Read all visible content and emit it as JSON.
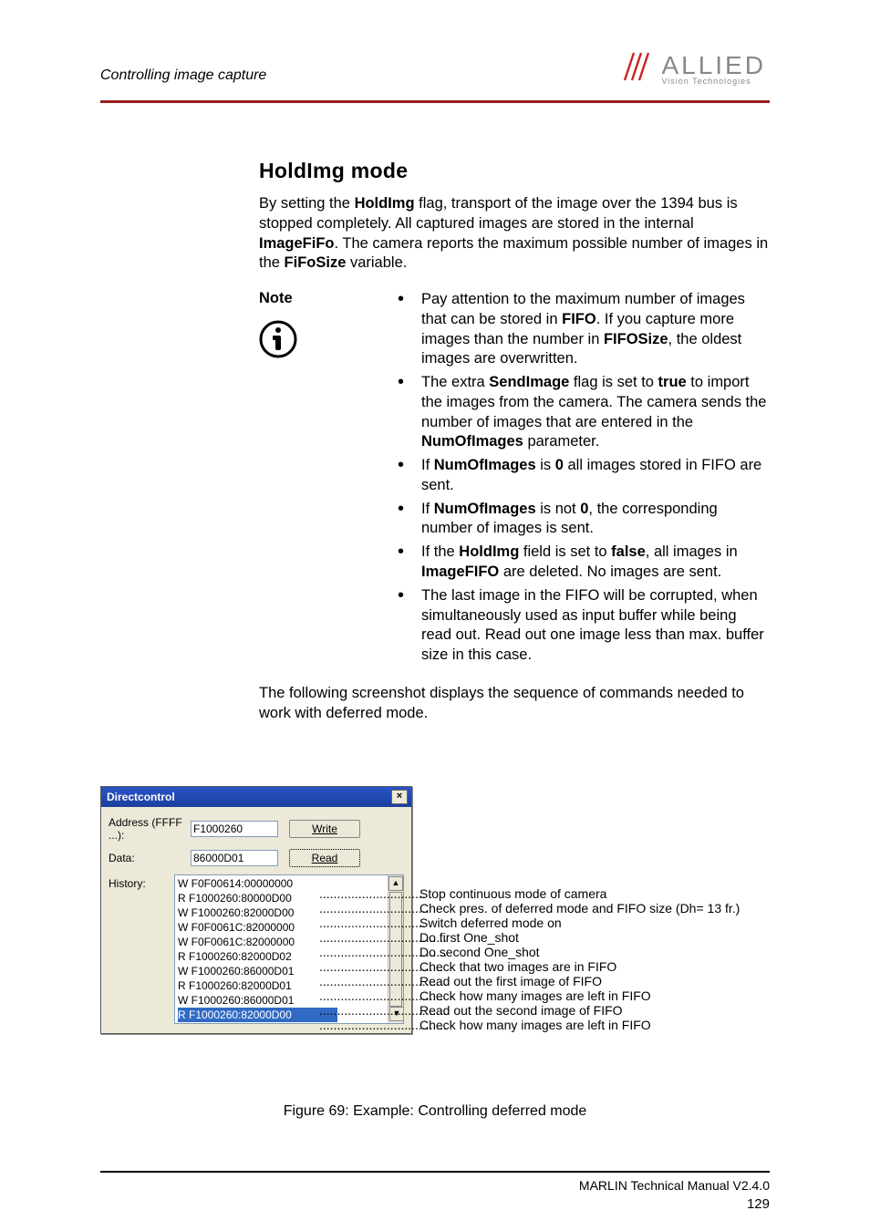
{
  "header": {
    "running": "Controlling image capture",
    "logo_main": "ALLIED",
    "logo_sub": "Vision Technologies"
  },
  "section": {
    "title": "HoldImg mode",
    "intro_html": "By setting the <b>HoldImg</b> flag, transport of the image over the 1394 bus is stopped completely. All captured images are stored in the internal <b>ImageFiFo</b>. The camera reports the maximum possible number of images in the <b>FiFoSize</b> variable."
  },
  "note": {
    "label": "Note",
    "items_html": [
      "Pay attention to the maximum number of images that can be stored in <b>FIFO</b>. If you capture more images than the number in <b>FIFOSize</b>, the oldest images are overwritten.",
      "The extra <b>SendImage</b> flag is set to <b>true</b> to import the images from the camera. The camera sends the number of images that are entered in the <b>NumOfImages</b> parameter.",
      "If <b>NumOfImages</b> is <b>0</b> all images stored in FIFO are sent.",
      "If <b>NumOfImages</b> is not <b>0</b>, the corresponding number of images is sent.",
      "If the <b>HoldImg</b> field is set to <b>false</b>, all images in <b>ImageFIFO</b> are deleted. No images are sent.",
      "The last image in the FIFO will be corrupted, when simultaneously used as input buffer while being read out. Read out one image less than max. buffer size in this case."
    ]
  },
  "following": "The following screenshot displays the sequence of commands needed to work with deferred mode.",
  "dc": {
    "title": "Directcontrol",
    "addr_label": "Address (FFFF ...):",
    "data_label": "Data:",
    "hist_label": "History:",
    "addr_value": "F1000260",
    "data_value": "86000D01",
    "btn_write": "Write",
    "btn_read": "Read",
    "history": [
      "W F0F00614:00000000",
      "R F1000260:80000D00",
      "W F1000260:82000D00",
      "W F0F0061C:82000000",
      "W F0F0061C:82000000",
      "R F1000260:82000D02",
      "W F1000260:86000D01",
      "R F1000260:82000D01",
      "W F1000260:86000D01",
      "R F1000260:82000D00"
    ]
  },
  "annotations": [
    "Stop continuous mode of camera",
    "Check pres. of deferred mode and FIFO size (Dh= 13 fr.)",
    "Switch deferred mode on",
    "Do first One_shot",
    "Do second One_shot",
    "Check that two images are in FIFO",
    "Read out the first image of FIFO",
    "Check how many images are left in FIFO",
    "Read out the second image of FIFO",
    "Check how many images are left in FIFO"
  ],
  "dots": [
    "..............................",
    "...............................",
    "..............................",
    "....................................",
    "....................................",
    "...................................",
    "....................................",
    "...................................",
    "....................................",
    "...................................."
  ],
  "figure_caption": "Figure 69: Example: Controlling deferred mode",
  "footer": {
    "doc": "MARLIN Technical Manual V2.4.0",
    "page": "129"
  }
}
